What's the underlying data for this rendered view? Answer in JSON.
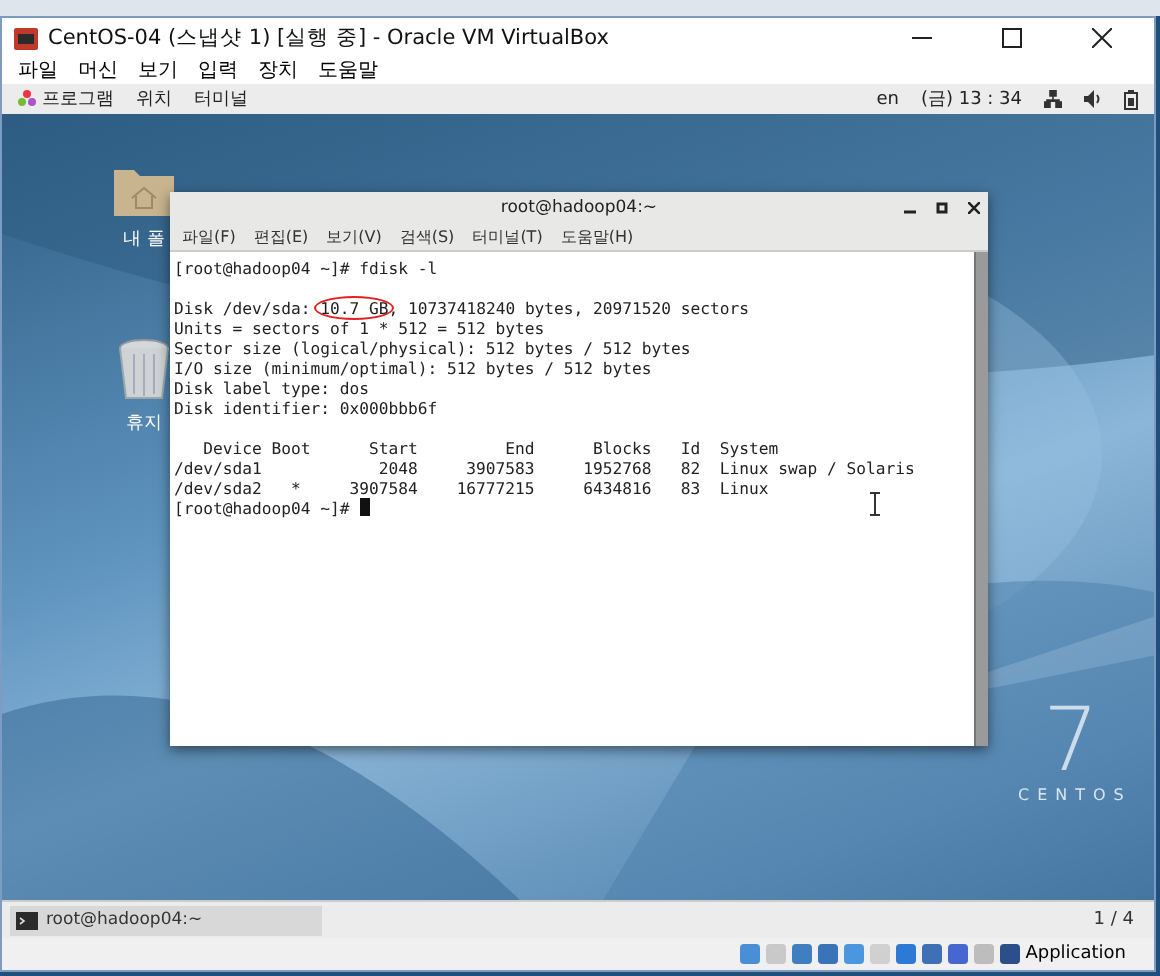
{
  "window": {
    "title": "CentOS-04 (스냅샷 1) [실행 중] - Oracle VM VirtualBox",
    "menu": [
      "파일",
      "머신",
      "보기",
      "입력",
      "장치",
      "도움말"
    ]
  },
  "top_bar": {
    "menu": [
      "프로그램",
      "위치",
      "터미널"
    ],
    "language": "en",
    "clock": "(금) 13 : 34"
  },
  "desktop_icons": [
    {
      "kind": "folder",
      "label": "내 폴"
    },
    {
      "kind": "trash",
      "label": "휴지"
    }
  ],
  "terminal": {
    "title": "root@hadoop04:~",
    "menu": [
      "파일(F)",
      "편집(E)",
      "보기(V)",
      "검색(S)",
      "터미널(T)",
      "도움말(H)"
    ],
    "blocks": [
      [
        "[root@hadoop04 ~]# fdisk -l"
      ],
      [
        {
          "before": "Disk /dev/sda: ",
          "circled": "10.7 GB",
          "after": ", 10737418240 bytes, 20971520 sectors"
        },
        "Units = sectors of 1 * 512 = 512 bytes",
        "Sector size (logical/physical): 512 bytes / 512 bytes",
        "I/O size (minimum/optimal): 512 bytes / 512 bytes",
        "Disk label type: dos",
        "Disk identifier: 0x000bbb6f"
      ],
      [
        "   Device Boot      Start         End      Blocks   Id  System",
        "/dev/sda1            2048     3907583     1952768   82  Linux swap / Solaris",
        "/dev/sda2   *     3907584    16777215     6434816   83  Linux"
      ]
    ],
    "prompt": "[root@hadoop04 ~]# "
  },
  "logo": {
    "number": "7",
    "name": "CENTOS"
  },
  "bottom_panel": {
    "task": "root@hadoop04:~",
    "workspace": "1 / 4"
  },
  "status_bar": {
    "label": "Application"
  }
}
